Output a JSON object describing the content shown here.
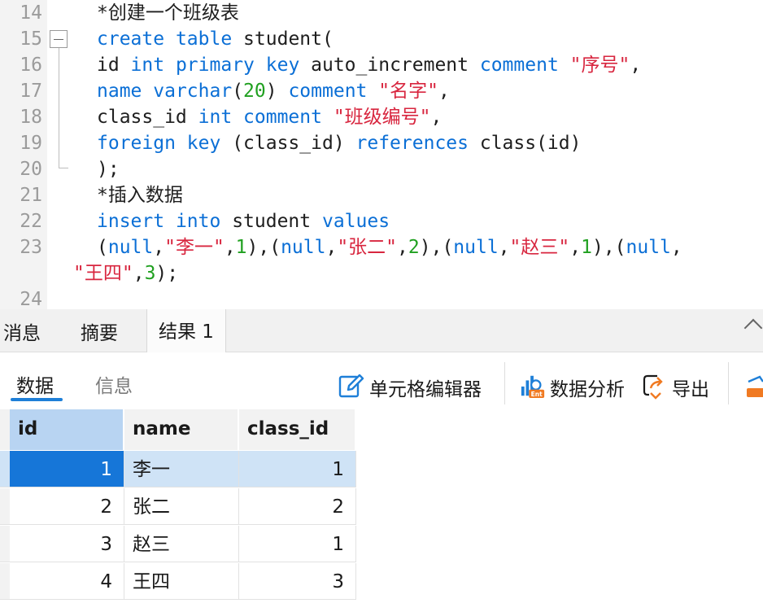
{
  "editor": {
    "line_numbers": [
      "14",
      "15",
      "16",
      "17",
      "18",
      "19",
      "20",
      "21",
      "22",
      "23",
      "24"
    ],
    "lines": {
      "l14": {
        "comment": "*创建一个班级表"
      },
      "l15": {
        "kw1": "create",
        "kw2": "table",
        "ident": " student("
      },
      "l16": {
        "t1": "id ",
        "kw1": "int",
        "kw2": "primary",
        "kw3": "key",
        "t2": " auto_increment ",
        "kw4": "comment",
        "str": "\"序号\"",
        "t3": ","
      },
      "l17": {
        "kw1": "name",
        "kw2": "varchar",
        "t1": "(",
        "num": "20",
        "t2": ") ",
        "kw3": "comment",
        "str": "\"名字\"",
        "t3": ","
      },
      "l18": {
        "t1": "class_id ",
        "kw1": "int",
        "kw2": "comment",
        "str": "\"班级编号\"",
        "t2": ","
      },
      "l19": {
        "kw1": "foreign",
        "kw2": "key",
        "t1": " (class_id) ",
        "kw3": "references",
        "t2": " class(id)"
      },
      "l20": {
        "t1": ");"
      },
      "l21": {
        "comment": "*插入数据"
      },
      "l22": {
        "kw1": "insert",
        "kw2": "into",
        "t1": " student ",
        "kw3": "values"
      },
      "l23": {
        "p1": "(",
        "n1": "null",
        "c1": ",",
        "s1": "\"李一\"",
        "c2": ",",
        "d1": "1",
        "e1": "),(",
        "n2": "null",
        "c3": ",",
        "s2": "\"张二\"",
        "c4": ",",
        "d2": "2",
        "e2": "),(",
        "n3": "null",
        "c5": ",",
        "s3": "\"赵三\"",
        "c6": ",",
        "d3": "1",
        "e3": "),(",
        "n4": "null",
        "c7": ","
      },
      "l23b": {
        "s4": "\"王四\"",
        "c8": ",",
        "d4": "3",
        "e4": ");"
      }
    }
  },
  "result_tabs": [
    "消息",
    "摘要",
    "结果 1"
  ],
  "subtabs": {
    "data": "数据",
    "info": "信息"
  },
  "toolbar": {
    "cell_editor": "单元格编辑器",
    "data_analysis": "数据分析",
    "export": "导出"
  },
  "icons": [
    "edit-icon",
    "data-analysis-icon",
    "export-icon",
    "collapse-chevron-icon"
  ],
  "colors": {
    "keyword": "#0b6fd6",
    "string": "#d8263f",
    "number": "#20a020",
    "selection": "#1676d8",
    "row_highlight": "#cfe3f6"
  },
  "grid": {
    "columns": [
      "id",
      "name",
      "class_id"
    ],
    "rows": [
      {
        "id": "1",
        "name": "李一",
        "class_id": "1"
      },
      {
        "id": "2",
        "name": "张二",
        "class_id": "2"
      },
      {
        "id": "3",
        "name": "赵三",
        "class_id": "1"
      },
      {
        "id": "4",
        "name": "王四",
        "class_id": "3"
      }
    ]
  }
}
